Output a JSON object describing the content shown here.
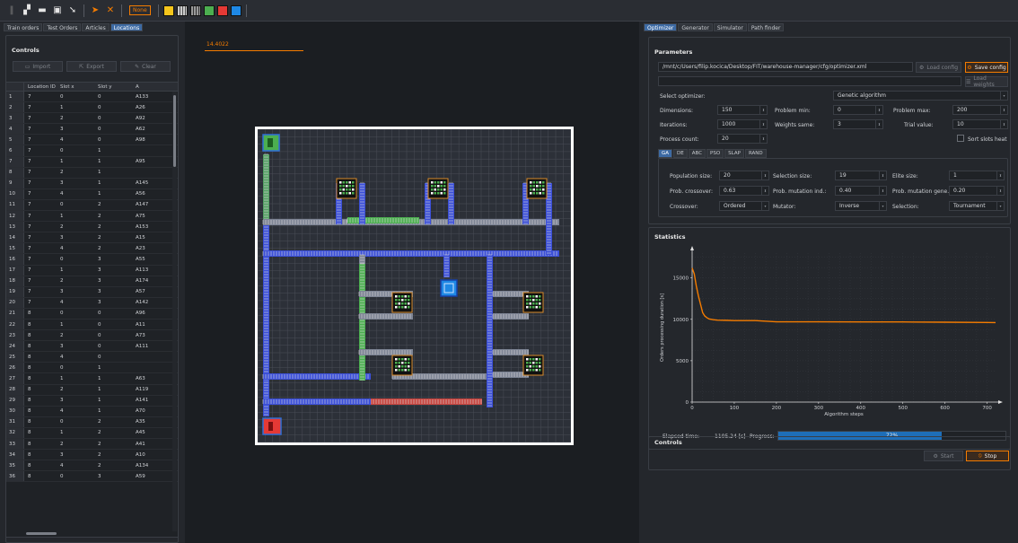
{
  "toolbar": {
    "mode_label": "None",
    "colors": {
      "yellow": "#f6c61c",
      "green": "#4caf50",
      "red": "#e53935",
      "blue": "#1e88e5",
      "orange_x": "#f57c00",
      "cursor": "#f57c00"
    }
  },
  "left": {
    "tabs": [
      "Train orders",
      "Test Orders",
      "Articles",
      "Locations"
    ],
    "active_tab": "Locations",
    "controls_title": "Controls",
    "buttons": {
      "import": "Import",
      "export": "Export",
      "clear": "Clear"
    },
    "table": {
      "headers": [
        "Location ID",
        "Slot x",
        "Slot y",
        "A"
      ],
      "rows": [
        [
          "1",
          "7",
          "0",
          "0",
          "A133"
        ],
        [
          "2",
          "7",
          "1",
          "0",
          "A26"
        ],
        [
          "3",
          "7",
          "2",
          "0",
          "A92"
        ],
        [
          "4",
          "7",
          "3",
          "0",
          "A62"
        ],
        [
          "5",
          "7",
          "4",
          "0",
          "A98"
        ],
        [
          "6",
          "7",
          "0",
          "1",
          ""
        ],
        [
          "7",
          "7",
          "1",
          "1",
          "A95"
        ],
        [
          "8",
          "7",
          "2",
          "1",
          ""
        ],
        [
          "9",
          "7",
          "3",
          "1",
          "A145"
        ],
        [
          "10",
          "7",
          "4",
          "1",
          "A56"
        ],
        [
          "11",
          "7",
          "0",
          "2",
          "A147"
        ],
        [
          "12",
          "7",
          "1",
          "2",
          "A75"
        ],
        [
          "13",
          "7",
          "2",
          "2",
          "A153"
        ],
        [
          "14",
          "7",
          "3",
          "2",
          "A15"
        ],
        [
          "15",
          "7",
          "4",
          "2",
          "A23"
        ],
        [
          "16",
          "7",
          "0",
          "3",
          "A55"
        ],
        [
          "17",
          "7",
          "1",
          "3",
          "A113"
        ],
        [
          "18",
          "7",
          "2",
          "3",
          "A174"
        ],
        [
          "19",
          "7",
          "3",
          "3",
          "A57"
        ],
        [
          "20",
          "7",
          "4",
          "3",
          "A142"
        ],
        [
          "21",
          "8",
          "0",
          "0",
          "A96"
        ],
        [
          "22",
          "8",
          "1",
          "0",
          "A11"
        ],
        [
          "23",
          "8",
          "2",
          "0",
          "A73"
        ],
        [
          "24",
          "8",
          "3",
          "0",
          "A111"
        ],
        [
          "25",
          "8",
          "4",
          "0",
          ""
        ],
        [
          "26",
          "8",
          "0",
          "1",
          ""
        ],
        [
          "27",
          "8",
          "1",
          "1",
          "A63"
        ],
        [
          "28",
          "8",
          "2",
          "1",
          "A119"
        ],
        [
          "29",
          "8",
          "3",
          "1",
          "A141"
        ],
        [
          "30",
          "8",
          "4",
          "1",
          "A70"
        ],
        [
          "31",
          "8",
          "0",
          "2",
          "A35"
        ],
        [
          "32",
          "8",
          "1",
          "2",
          "A45"
        ],
        [
          "33",
          "8",
          "2",
          "2",
          "A41"
        ],
        [
          "34",
          "8",
          "3",
          "2",
          "A10"
        ],
        [
          "35",
          "8",
          "4",
          "2",
          "A134"
        ],
        [
          "36",
          "8",
          "0",
          "3",
          "A59"
        ]
      ]
    }
  },
  "center": {
    "time_value": "14.4022"
  },
  "right": {
    "tabs": [
      "Optimizer",
      "Generator",
      "Simulator",
      "Path finder"
    ],
    "active_tab": "Optimizer",
    "params_title": "Parameters",
    "config_path": "/mnt/c/Users/filip.kocica/Desktop/FIT/warehouse-manager/cfg/optimizer.xml",
    "load_config": "Load config",
    "save_config": "Save config",
    "load_weights": "Load weights",
    "select_optimizer_label": "Select optimizer:",
    "optimizer_value": "Genetic algorithm",
    "dimensions_label": "Dimensions:",
    "dimensions": "150",
    "problem_min_label": "Problem min:",
    "problem_min": "0",
    "problem_max_label": "Problem max:",
    "problem_max": "200",
    "iterations_label": "Iterations:",
    "iterations": "1000",
    "weights_same_label": "Weights same:",
    "weights_same": "3",
    "trial_value_label": "Trial value:",
    "trial_value": "10",
    "process_count_label": "Process count:",
    "process_count": "20",
    "sort_slots_label": "Sort slots heat",
    "algo_tabs": [
      "GA",
      "DE",
      "ABC",
      "PSO",
      "SLAP",
      "RAND"
    ],
    "active_algo": "GA",
    "population_label": "Population size:",
    "population": "20",
    "selection_size_label": "Selection size:",
    "selection_size": "19",
    "elite_label": "Elite size:",
    "elite": "1",
    "prob_cross_label": "Prob. crossover:",
    "prob_cross": "0.63",
    "prob_mut_ind_label": "Prob. mutation ind.:",
    "prob_mut_ind": "0.40",
    "prob_mut_gene_label": "Prob. mutation gene.:",
    "prob_mut_gene": "0.20",
    "crossover_label": "Crossover:",
    "crossover": "Ordered",
    "mutator_label": "Mutator:",
    "mutator": "Inverse",
    "selection_label": "Selection:",
    "selection": "Tournament",
    "stats_title": "Statistics",
    "elapsed_label": "Elapsed time:",
    "elapsed": "1105.24 [s]",
    "progress_label": "Progress:",
    "progress_text": "72%",
    "progress": 0.72,
    "controls_title": "Controls",
    "start": "Start",
    "stop": "Stop"
  },
  "chart_data": {
    "type": "line",
    "title": "",
    "xlabel": "Algorithm steps",
    "ylabel": "Orders processing duration [s]",
    "xlim": [
      0,
      720
    ],
    "ylim": [
      0,
      18000
    ],
    "xticks": [
      "0",
      "100",
      "200",
      "300",
      "400",
      "500",
      "600",
      "700"
    ],
    "yticks": [
      "0",
      "5000",
      "10000",
      "15000"
    ],
    "grid": true,
    "series": [
      {
        "x": [
          0,
          5,
          10,
          15,
          20,
          25,
          30,
          35,
          40,
          50,
          60,
          80,
          100,
          150,
          200,
          250,
          300,
          400,
          500,
          600,
          700,
          720
        ],
        "y": [
          16200,
          15500,
          14000,
          12800,
          11800,
          10800,
          10400,
          10200,
          10050,
          9950,
          9900,
          9880,
          9850,
          9850,
          9700,
          9700,
          9700,
          9680,
          9680,
          9650,
          9620,
          9600
        ]
      }
    ],
    "color": "#f57c00"
  }
}
